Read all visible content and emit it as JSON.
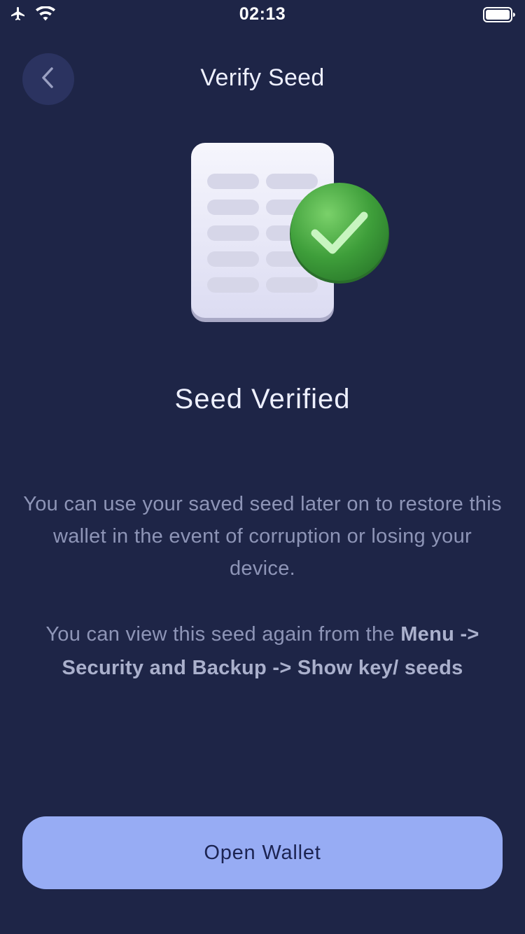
{
  "status_bar": {
    "time": "02:13",
    "icons": [
      "airplane-icon",
      "wifi-icon",
      "battery-icon"
    ]
  },
  "header": {
    "title": "Verify Seed",
    "back_icon": "chevron-left-icon"
  },
  "illustration": {
    "icon": "document-check-icon",
    "accent_color": "#4caf50"
  },
  "content": {
    "headline": "Seed Verified",
    "paragraph_1": "You can use your saved seed later on to restore this wallet in the event of corruption or losing your device.",
    "paragraph_2_prefix": "You can view this seed again from the ",
    "paragraph_2_path": "Menu -> Security and Backup -> Show key/ seeds"
  },
  "actions": {
    "open_wallet_label": "Open Wallet"
  },
  "colors": {
    "background": "#1e2547",
    "button": "#97acf4",
    "button_text": "#1c2452",
    "muted_text": "#8e95b7"
  }
}
